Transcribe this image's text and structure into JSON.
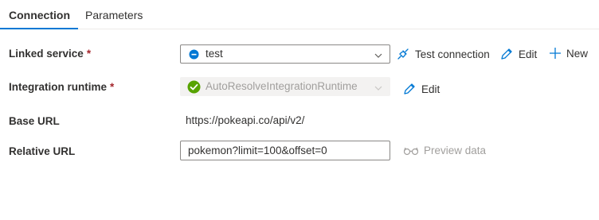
{
  "tabs": [
    {
      "label": "Connection",
      "active": true
    },
    {
      "label": "Parameters",
      "active": false
    }
  ],
  "linked_service": {
    "label": "Linked service",
    "required_marker": "*",
    "value": "test",
    "icon": "linked-service-status-icon"
  },
  "actions": {
    "test_connection": "Test connection",
    "edit": "Edit",
    "new": "New"
  },
  "integration_runtime": {
    "label": "Integration runtime",
    "required_marker": "*",
    "value": "AutoResolveIntegrationRuntime",
    "edit": "Edit"
  },
  "base_url": {
    "label": "Base URL",
    "value": "https://pokeapi.co/api/v2/"
  },
  "relative_url": {
    "label": "Relative URL",
    "value": "pokemon?limit=100&offset=0",
    "preview": "Preview data"
  },
  "colors": {
    "accent": "#0078d4",
    "required": "#a4262c",
    "success": "#57a300",
    "disabled_text": "#a19f9d"
  }
}
